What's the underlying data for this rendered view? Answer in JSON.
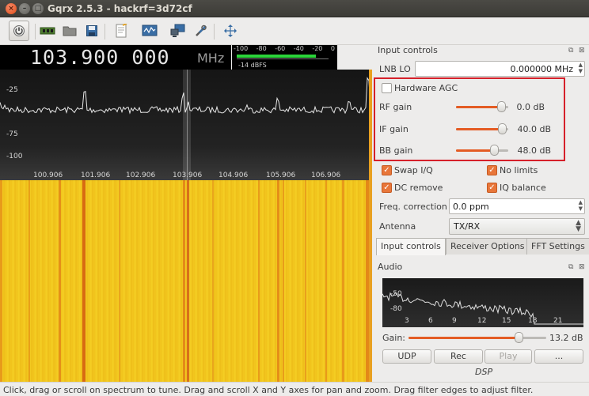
{
  "window": {
    "title": "Gqrx 2.5.3 - hackrf=3d72cf",
    "close": "×",
    "minimize": "–",
    "maximize": "□"
  },
  "toolbar": {
    "items": [
      "power-icon",
      "hardware-icon",
      "open-icon",
      "save-icon",
      "notes-icon",
      "iq-tool-icon",
      "remote-icon",
      "settings-icon",
      "resize-icon"
    ]
  },
  "frequency": {
    "digits": "103.900 000",
    "unit": "MHz"
  },
  "signal_meter": {
    "ticks": [
      "-100",
      "-80",
      "-60",
      "-40",
      "-20",
      "0"
    ],
    "level_label": "-14 dBFS",
    "level_fraction": 0.86
  },
  "spectrum": {
    "y_labels": [
      "-25",
      "-75",
      "-100"
    ],
    "x_labels": [
      "100.906",
      "101.906",
      "102.906",
      "103.906",
      "104.906",
      "105.906",
      "106.906"
    ]
  },
  "input_controls": {
    "title": "Input controls",
    "lnb_label": "LNB LO",
    "lnb_value": "0.000000 MHz",
    "hardware_agc": {
      "label": "Hardware AGC",
      "checked": false
    },
    "gains": [
      {
        "label": "RF gain",
        "value": "0.0 dB",
        "fraction": 0.86
      },
      {
        "label": "IF gain",
        "value": "40.0 dB",
        "fraction": 0.88
      },
      {
        "label": "BB gain",
        "value": "48.0 dB",
        "fraction": 0.73
      }
    ],
    "checks": [
      {
        "label": "Swap I/Q",
        "checked": true
      },
      {
        "label": "No limits",
        "checked": true
      },
      {
        "label": "DC remove",
        "checked": true
      },
      {
        "label": "IQ balance",
        "checked": true
      }
    ],
    "freq_correction_label": "Freq. correction",
    "freq_correction_value": "0.0 ppm",
    "antenna_label": "Antenna",
    "antenna_value": "TX/RX"
  },
  "tabs": [
    "Input controls",
    "Receiver Options",
    "FFT Settings"
  ],
  "audio": {
    "title": "Audio",
    "y_labels": [
      "-50",
      "-80"
    ],
    "x_labels": [
      "3",
      "6",
      "9",
      "12",
      "15",
      "18",
      "21"
    ],
    "gain_label": "Gain:",
    "gain_value": "13.2 dB",
    "gain_fraction": 0.8,
    "buttons": [
      "UDP",
      "Rec",
      "Play",
      "..."
    ]
  },
  "dsp_label": "DSP",
  "status": "Click, drag or scroll on spectrum to tune. Drag and scroll X and Y axes for pan and zoom. Drag filter edges to adjust filter.",
  "colors": {
    "accent": "#e45c24",
    "highlight": "#d6202a",
    "waterfall": "#f0c21b",
    "meter_bar": "#2bd43a"
  }
}
